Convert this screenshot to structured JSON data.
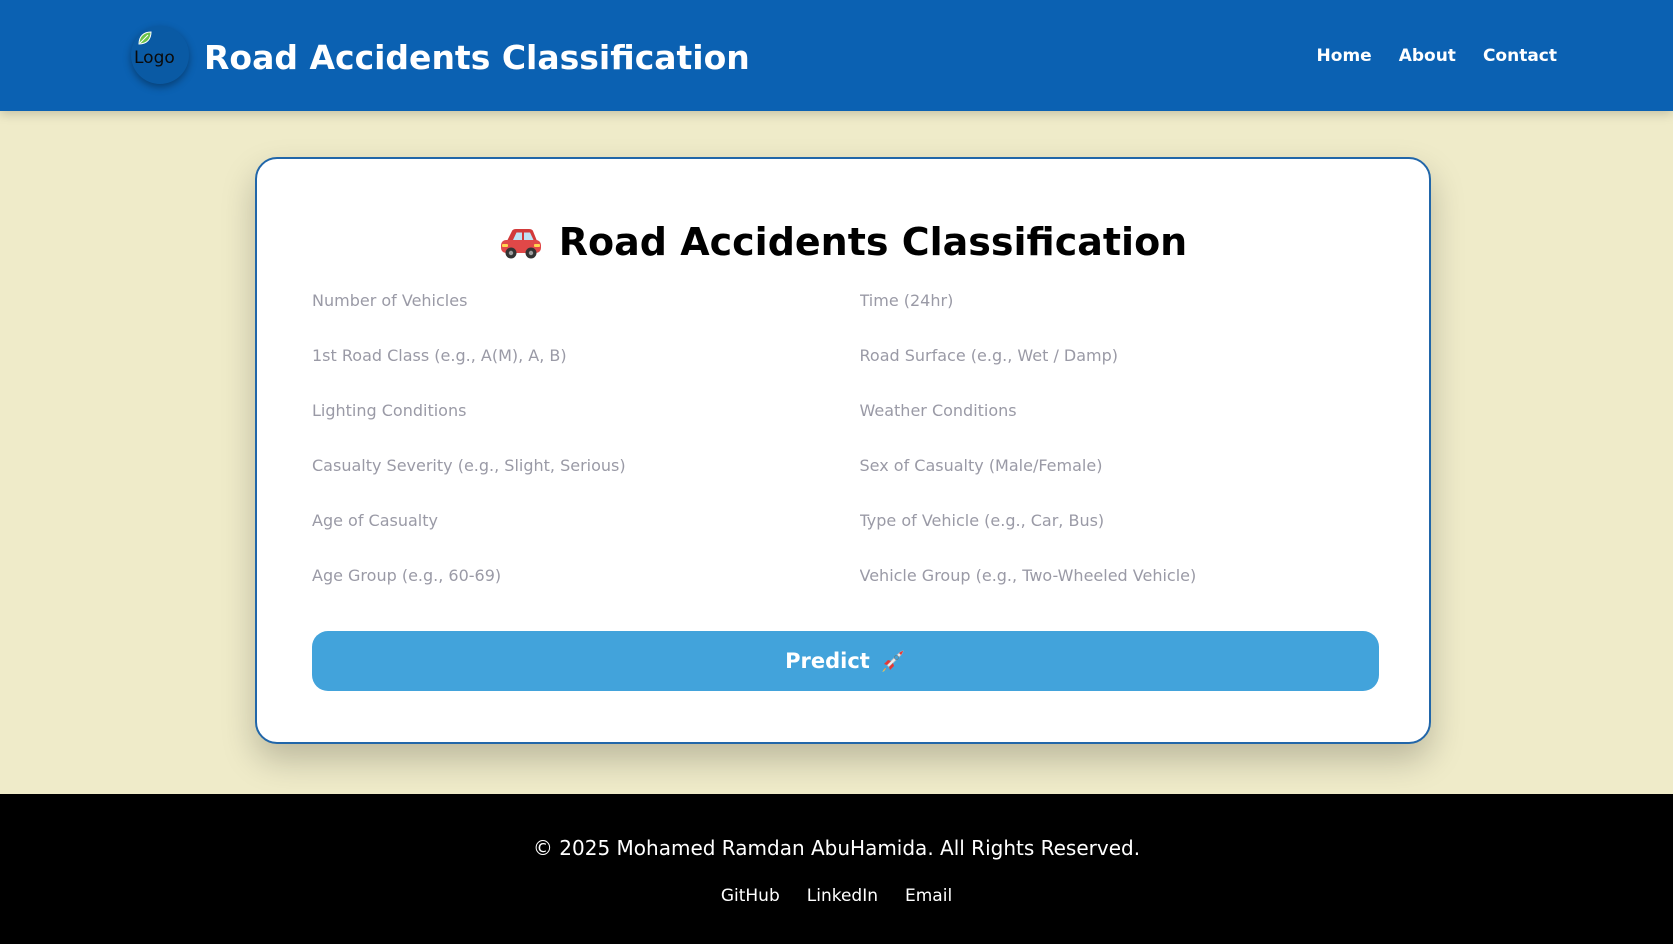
{
  "header": {
    "logo_alt": "Logo",
    "title": "Road Accidents Classification",
    "nav": [
      "Home",
      "About",
      "Contact"
    ]
  },
  "form": {
    "title": "Road Accidents Classification",
    "title_icon": "car-icon",
    "fields": [
      {
        "placeholder": "Number of Vehicles",
        "value": ""
      },
      {
        "placeholder": "Time (24hr)",
        "value": ""
      },
      {
        "placeholder": "1st Road Class (e.g., A(M), A, B)",
        "value": ""
      },
      {
        "placeholder": "Road Surface (e.g., Wet / Damp)",
        "value": ""
      },
      {
        "placeholder": "Lighting Conditions",
        "value": ""
      },
      {
        "placeholder": "Weather Conditions",
        "value": ""
      },
      {
        "placeholder": "Casualty Severity (e.g., Slight, Serious)",
        "value": ""
      },
      {
        "placeholder": "Sex of Casualty (Male/Female)",
        "value": ""
      },
      {
        "placeholder": "Age of Casualty",
        "value": ""
      },
      {
        "placeholder": "Type of Vehicle (e.g., Car, Bus)",
        "value": ""
      },
      {
        "placeholder": "Age Group (e.g., 60-69)",
        "value": ""
      },
      {
        "placeholder": "Vehicle Group (e.g., Two-Wheeled Vehicle)",
        "value": ""
      }
    ],
    "predict_label": "Predict",
    "predict_icon": "rocket-icon"
  },
  "footer": {
    "copyright": "© 2025 Mohamed Ramdan AbuHamida. All Rights Reserved.",
    "links": [
      "GitHub",
      "LinkedIn",
      "Email"
    ]
  },
  "colors": {
    "header_bg": "#0b61b2",
    "page_bg": "#efebc9",
    "card_border": "#2166a9",
    "button_bg": "#42a3db",
    "footer_bg": "#000000"
  }
}
